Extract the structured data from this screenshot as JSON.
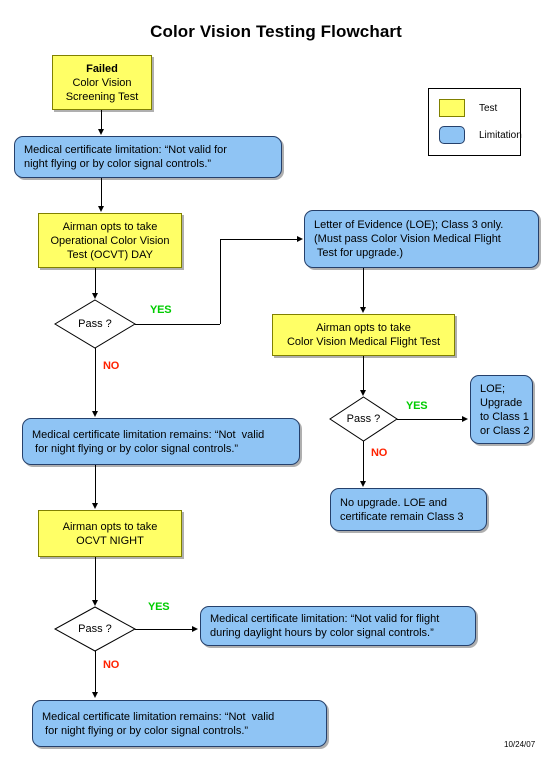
{
  "title": "Color Vision Testing Flowchart",
  "datestamp": "10/24/07",
  "legend": {
    "items": [
      {
        "label": "Test",
        "color": "#ffff66"
      },
      {
        "label": "Limitation",
        "color": "#8fc4f4"
      }
    ]
  },
  "colors": {
    "test_fill": "#ffff66",
    "test_border": "#808000",
    "limitation_fill": "#8fc4f4",
    "limitation_border": "#25406b",
    "yes_label": "#00cc00",
    "no_label": "#ff2200",
    "connector": "#000000",
    "background": "#ffffff"
  },
  "labels": {
    "yes": "YES",
    "no": "NO",
    "pass": "Pass ?"
  },
  "nodes": {
    "failed_screening": {
      "type": "test",
      "line1": "Failed",
      "line2": "Color Vision",
      "line3": "Screening Test"
    },
    "limitation_night": {
      "type": "limitation",
      "line1": "Medical certificate limitation: “Not valid for",
      "line2": "night flying or by color signal controls.”"
    },
    "ocvt_day": {
      "type": "test",
      "line1": "Airman opts to take",
      "line2": "Operational Color Vision",
      "line3": "Test (OCVT) DAY"
    },
    "pass_day": {
      "type": "decision",
      "label": "Pass ?"
    },
    "loe_class3": {
      "type": "limitation",
      "line1": "Letter of Evidence (LOE); Class 3 only.",
      "line2": "(Must pass Color Vision Medical Flight",
      "line3": " Test for upgrade.)"
    },
    "medical_flight_test": {
      "type": "test",
      "line1": "Airman opts to take",
      "line2": "Color Vision Medical Flight Test"
    },
    "pass_flight": {
      "type": "decision",
      "label": "Pass ?"
    },
    "loe_upgrade": {
      "type": "limitation",
      "line1": "LOE;",
      "line2": "Upgrade",
      "line3": "to Class 1",
      "line4": "or Class 2"
    },
    "no_upgrade": {
      "type": "limitation",
      "line1": "No upgrade. LOE and",
      "line2": "certificate remain Class 3"
    },
    "limitation_remains_day": {
      "type": "limitation",
      "line1": "Medical certificate limitation remains: “Not  valid",
      "line2": " for night flying or by color signal controls.”"
    },
    "ocvt_night": {
      "type": "test",
      "line1": "Airman opts to take",
      "line2": "OCVT NIGHT"
    },
    "pass_night": {
      "type": "decision",
      "label": "Pass ?"
    },
    "limitation_daylight": {
      "type": "limitation",
      "line1": "Medical certificate limitation: “Not valid for flight",
      "line2": "during daylight hours by color signal controls.”"
    },
    "limitation_remains_night": {
      "type": "limitation",
      "line1": "Medical certificate limitation remains: “Not  valid",
      "line2": " for night flying or by color signal controls.”"
    }
  }
}
